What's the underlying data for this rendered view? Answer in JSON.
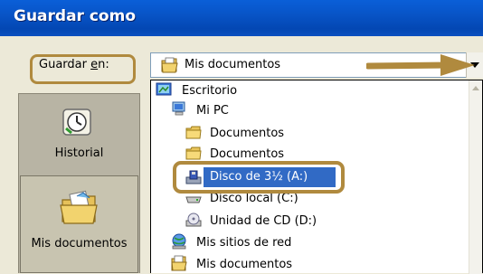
{
  "window": {
    "title": "Guardar como"
  },
  "save_in": {
    "label_prefix": "Guardar ",
    "label_accel": "e",
    "label_suffix": "n:",
    "current_value": "Mis documentos"
  },
  "places": [
    {
      "label": "Historial",
      "icon": "history-clock-icon"
    },
    {
      "label": "Mis documentos",
      "icon": "my-documents-folder-icon",
      "selected": true
    }
  ],
  "dropdown_items": [
    {
      "label": "Escritorio",
      "icon": "desktop-icon"
    },
    {
      "label": "Mi PC",
      "icon": "my-computer-icon"
    },
    {
      "label": "Documentos",
      "icon": "folder-icon"
    },
    {
      "label": "Documentos",
      "icon": "folder-icon"
    },
    {
      "label": "Disco de 3½ (A:)",
      "icon": "floppy-drive-icon",
      "selected": true
    },
    {
      "label": "Disco local (C:)",
      "icon": "hard-drive-icon"
    },
    {
      "label": "Unidad de CD (D:)",
      "icon": "cd-drive-icon"
    },
    {
      "label": "Mis sitios de red",
      "icon": "network-places-icon"
    },
    {
      "label": "Mis documentos",
      "icon": "my-documents-icon"
    }
  ],
  "colors": {
    "titlebar": "#0854c7",
    "selection": "#316ac5",
    "annotation": "#b08a3e",
    "window_bg": "#ece9d8"
  }
}
